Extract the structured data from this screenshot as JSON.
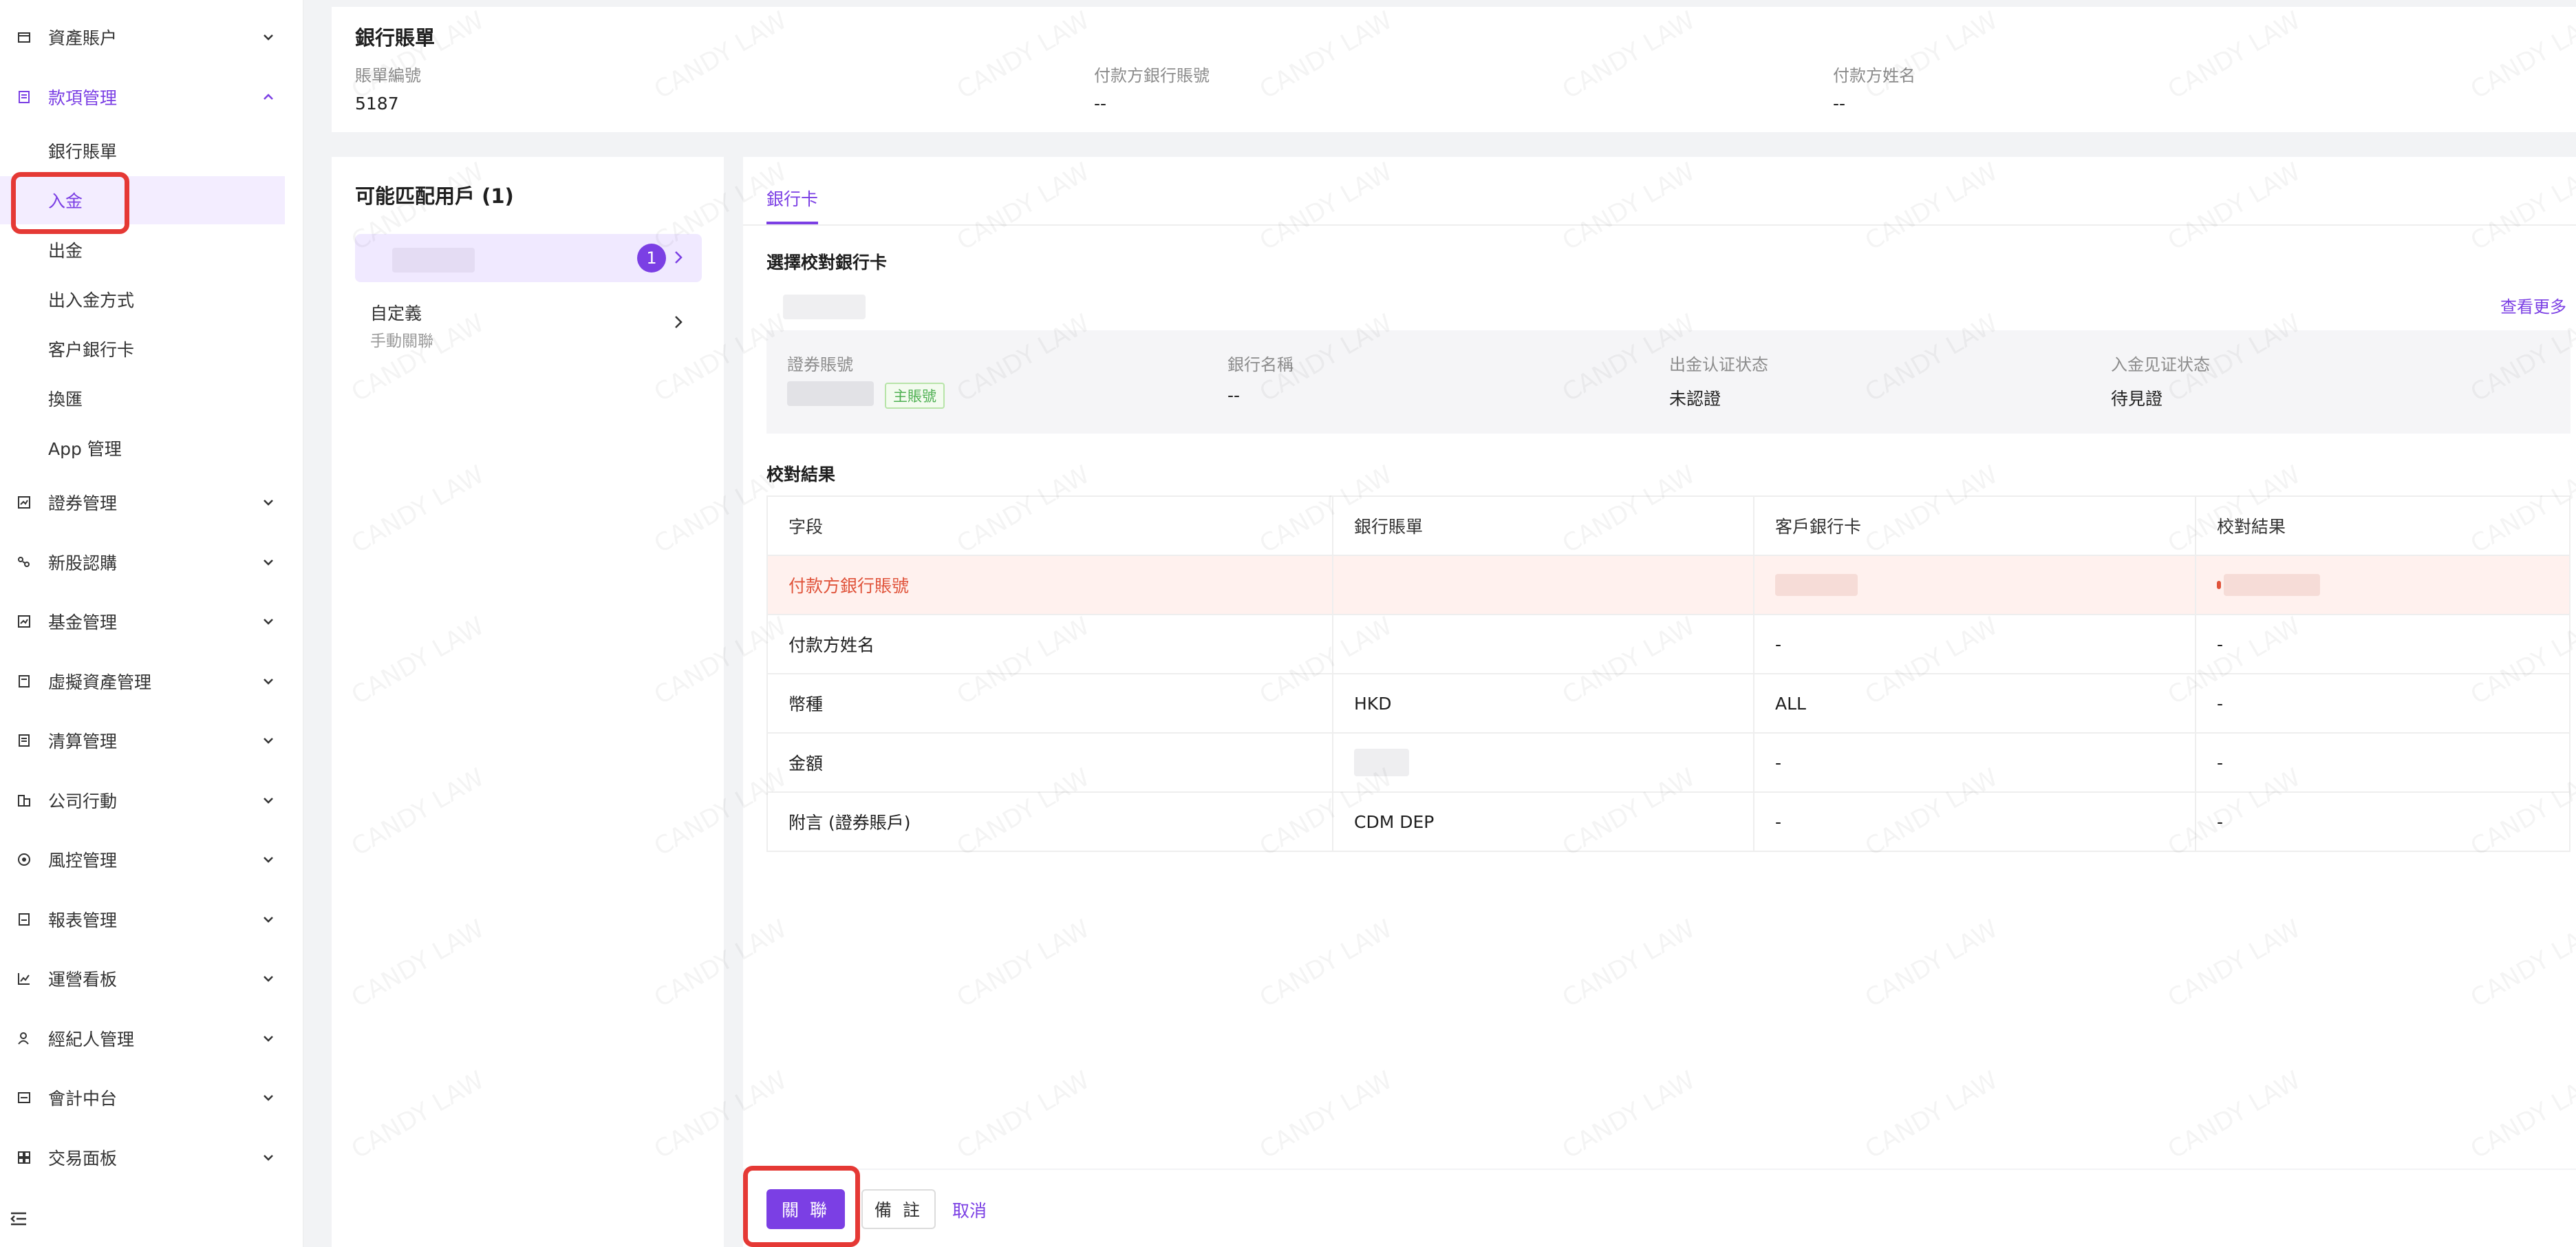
{
  "sidebar": {
    "items": [
      {
        "label": "資產賬户",
        "icon": "asset-icon"
      },
      {
        "label": "款項管理",
        "icon": "payment-icon",
        "expanded": true
      },
      {
        "label": "證券管理",
        "icon": "securities-icon"
      },
      {
        "label": "新股認購",
        "icon": "ipo-icon"
      },
      {
        "label": "基金管理",
        "icon": "fund-icon"
      },
      {
        "label": "虛擬資產管理",
        "icon": "virtual-asset-icon"
      },
      {
        "label": "清算管理",
        "icon": "clearing-icon"
      },
      {
        "label": "公司行動",
        "icon": "corporate-action-icon"
      },
      {
        "label": "風控管理",
        "icon": "risk-icon"
      },
      {
        "label": "報表管理",
        "icon": "report-icon"
      },
      {
        "label": "運營看板",
        "icon": "dashboard-icon"
      },
      {
        "label": "經紀人管理",
        "icon": "broker-icon"
      },
      {
        "label": "會計中台",
        "icon": "accounting-icon"
      },
      {
        "label": "交易面板",
        "icon": "trading-icon"
      }
    ],
    "sub_items": [
      {
        "label": "銀行賬單"
      },
      {
        "label": "入金",
        "active": true
      },
      {
        "label": "出金"
      },
      {
        "label": "出入金方式"
      },
      {
        "label": "客户銀行卡"
      },
      {
        "label": "換匯"
      },
      {
        "label": "App 管理"
      }
    ]
  },
  "bill": {
    "title": "銀行賬單",
    "fields": [
      {
        "label": "賬單編號",
        "value": "5187"
      },
      {
        "label": "付款方銀行賬號",
        "value": "--"
      },
      {
        "label": "付款方姓名",
        "value": "--"
      }
    ]
  },
  "match": {
    "title": "可能匹配用戶 (1)",
    "candidate_badge": "1",
    "custom_label": "自定義",
    "custom_sub": "手動關聯"
  },
  "detail": {
    "tab": "銀行卡",
    "select_card_title": "選擇校對銀行卡",
    "see_more": "查看更多",
    "card_fields": [
      {
        "label": "證券賬號",
        "value": "",
        "tag": "主賬號"
      },
      {
        "label": "銀行名稱",
        "value": "--"
      },
      {
        "label": "出金认证状态",
        "value": "未認證"
      },
      {
        "label": "入金见证状态",
        "value": "待見證"
      }
    ],
    "result_title": "校對結果",
    "table": {
      "headers": [
        "字段",
        "銀行賬單",
        "客戶銀行卡",
        "校對結果"
      ],
      "rows": [
        {
          "field": "付款方銀行賬號",
          "bill": "",
          "card": "",
          "result": "",
          "error": true
        },
        {
          "field": "付款方姓名",
          "bill": "",
          "card": "-",
          "result": "-"
        },
        {
          "field": "幣種",
          "bill": "HKD",
          "card": "ALL",
          "result": "-"
        },
        {
          "field": "金額",
          "bill": "",
          "card": "-",
          "result": "-"
        },
        {
          "field": "附言 (證券賬戶)",
          "bill": "CDM DEP",
          "card": "-",
          "result": "-"
        }
      ]
    }
  },
  "actions": {
    "associate": "關 聯",
    "remark": "備 註",
    "cancel": "取消"
  },
  "watermark": "CANDY LAW",
  "colors": {
    "accent": "#7b3fe4",
    "error": "#e0533a",
    "highlight": "#e53935"
  }
}
